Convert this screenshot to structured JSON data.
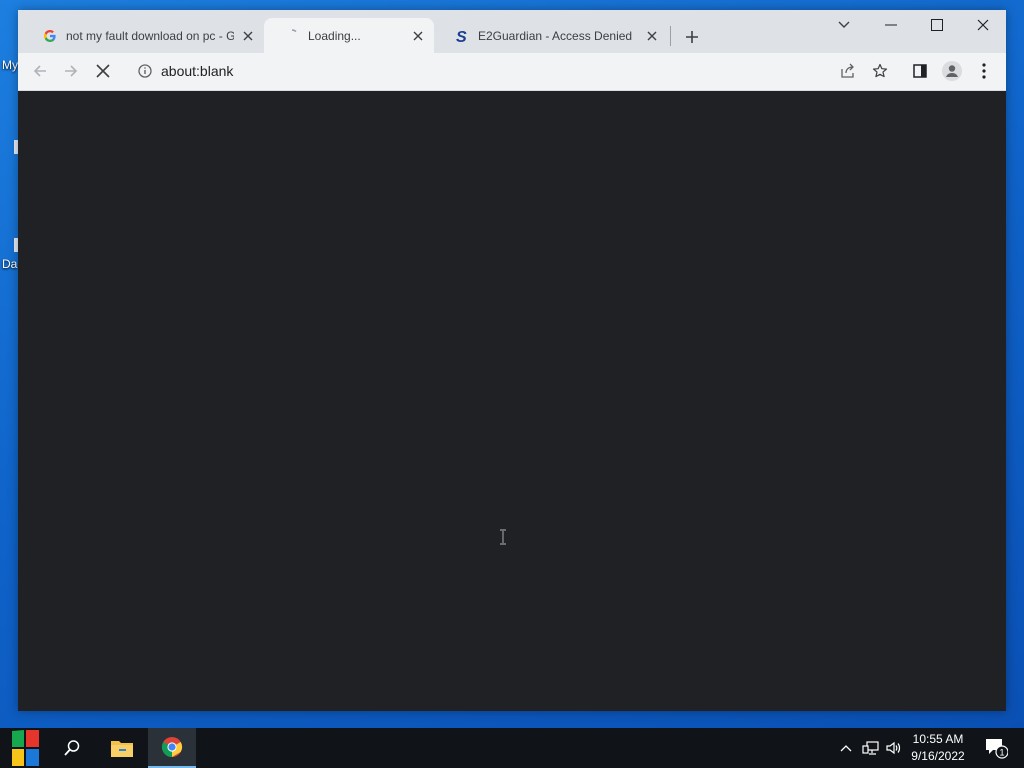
{
  "desktop": {
    "icon_labels": [
      "My",
      "Da"
    ]
  },
  "browser": {
    "tabs": [
      {
        "title": "not my fault download on pc - G",
        "favicon": "google-icon",
        "active": false
      },
      {
        "title": "Loading...",
        "favicon": "loading-icon",
        "active": true
      },
      {
        "title": "E2Guardian - Access Denied",
        "favicon": "e2guardian-icon",
        "active": false
      }
    ],
    "address": "about:blank",
    "colors": {
      "tabstrip": "#dee1e6",
      "toolbar": "#f1f3f4",
      "content": "#202124"
    }
  },
  "taskbar": {
    "time": "10:55 AM",
    "date": "9/16/2022",
    "notification_count": "1",
    "colors": {
      "background": "#101418",
      "accent": "#76b9ed"
    }
  }
}
